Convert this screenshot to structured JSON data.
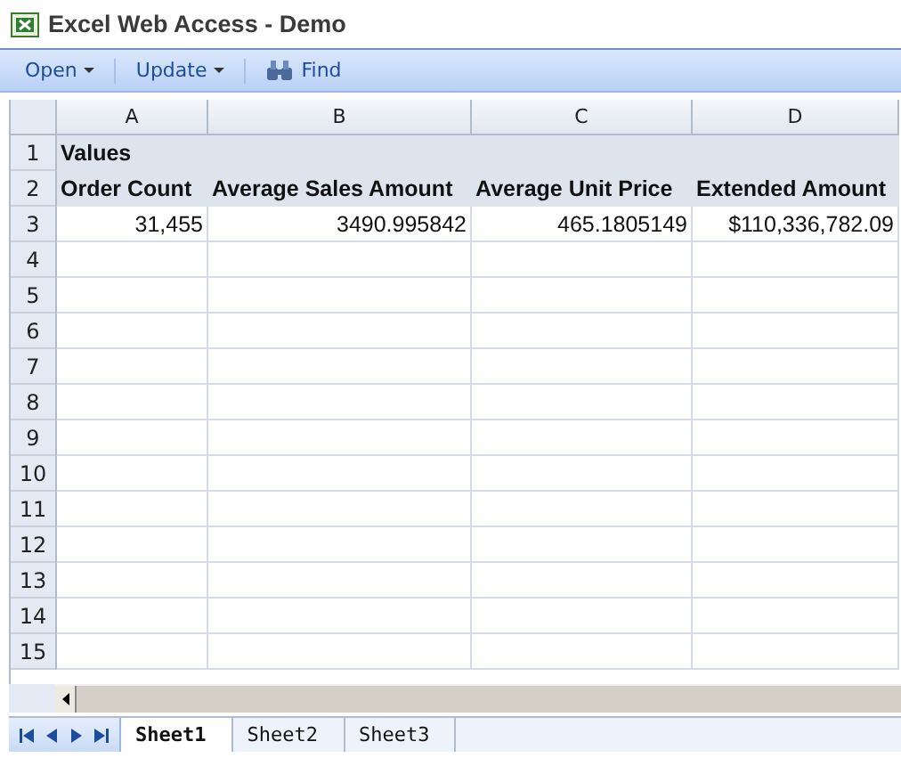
{
  "window": {
    "title": "Excel Web Access - Demo"
  },
  "toolbar": [
    {
      "label": "Open",
      "kind": "menu"
    },
    {
      "label": "Update",
      "kind": "menu"
    },
    {
      "label": "Find",
      "kind": "find"
    }
  ],
  "columns": [
    "A",
    "B",
    "C",
    "D"
  ],
  "rows": [
    {
      "number": "1",
      "kind": "label",
      "cells": [
        "Values",
        "",
        "",
        ""
      ]
    },
    {
      "number": "2",
      "kind": "label",
      "cells": [
        "Order Count",
        "Average Sales Amount",
        "Average Unit Price",
        "Extended Amount"
      ]
    },
    {
      "number": "3",
      "kind": "data",
      "cells": [
        "31,455",
        "3490.995842",
        "465.1805149",
        "$110,336,782.09"
      ]
    },
    {
      "number": "4",
      "kind": "data",
      "cells": [
        "",
        "",
        "",
        ""
      ]
    },
    {
      "number": "5",
      "kind": "data",
      "cells": [
        "",
        "",
        "",
        ""
      ]
    },
    {
      "number": "6",
      "kind": "data",
      "cells": [
        "",
        "",
        "",
        ""
      ]
    },
    {
      "number": "7",
      "kind": "data",
      "cells": [
        "",
        "",
        "",
        ""
      ]
    },
    {
      "number": "8",
      "kind": "data",
      "cells": [
        "",
        "",
        "",
        ""
      ]
    },
    {
      "number": "9",
      "kind": "data",
      "cells": [
        "",
        "",
        "",
        ""
      ]
    },
    {
      "number": "10",
      "kind": "data",
      "cells": [
        "",
        "",
        "",
        ""
      ]
    },
    {
      "number": "11",
      "kind": "data",
      "cells": [
        "",
        "",
        "",
        ""
      ]
    },
    {
      "number": "12",
      "kind": "data",
      "cells": [
        "",
        "",
        "",
        ""
      ]
    },
    {
      "number": "13",
      "kind": "data",
      "cells": [
        "",
        "",
        "",
        ""
      ]
    },
    {
      "number": "14",
      "kind": "data",
      "cells": [
        "",
        "",
        "",
        ""
      ]
    },
    {
      "number": "15",
      "kind": "data",
      "cells": [
        "",
        "",
        "",
        ""
      ]
    }
  ],
  "sheets": [
    {
      "label": "Sheet1",
      "selected": true
    },
    {
      "label": "Sheet2",
      "selected": false
    },
    {
      "label": "Sheet3",
      "selected": false
    }
  ]
}
